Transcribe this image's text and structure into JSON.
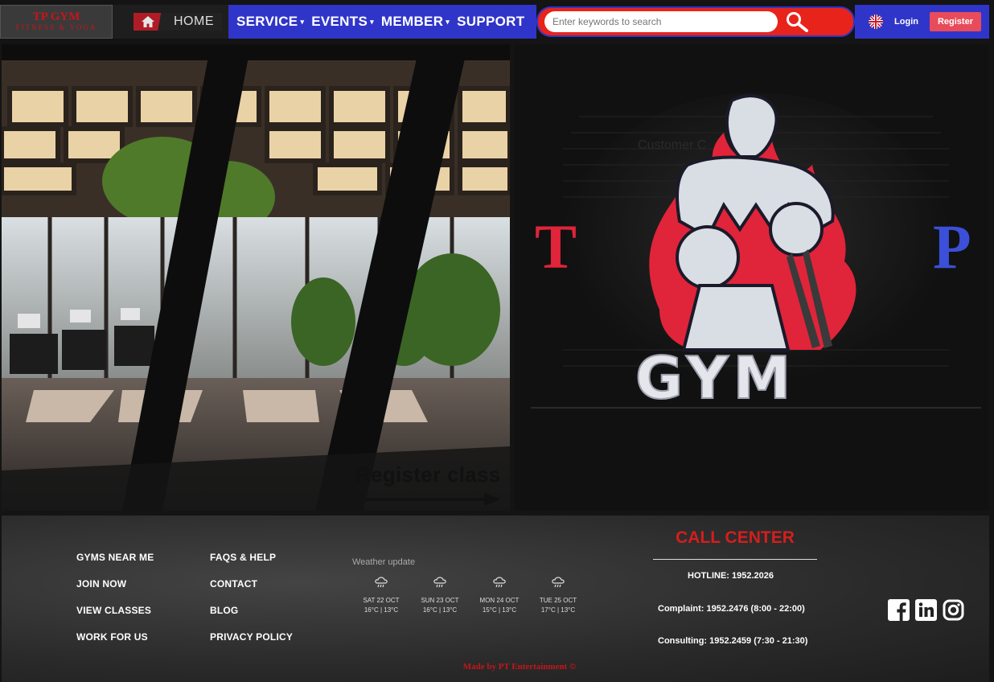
{
  "header": {
    "brand_title": "TP GYM",
    "brand_subtitle": "FITNESS & YOGA",
    "home_label": "HOME",
    "nav": [
      {
        "label": "SERVICE",
        "caret": "▾"
      },
      {
        "label": "EVENTS",
        "caret": "▾"
      },
      {
        "label": "MEMBER",
        "caret": "▾"
      },
      {
        "label": "SUPPORT",
        "caret": ""
      }
    ],
    "search_placeholder": "Enter keywords to search",
    "login_label": "Login",
    "register_label": "Register",
    "language_icon": "uk-flag-icon"
  },
  "hero": {
    "register_class_label": "Register class",
    "customer_label": "Customer C",
    "logo_text": "TP GYM"
  },
  "footer": {
    "links_col1": [
      "GYMS NEAR ME",
      "JOIN NOW",
      "VIEW CLASSES",
      "WORK FOR US"
    ],
    "links_col2": [
      "FAQS & HELP",
      "CONTACT",
      "BLOG",
      "PRIVACY POLICY"
    ],
    "weather_title": "Weather update",
    "weather": [
      {
        "day": "SAT 22 OCT",
        "temp": "16°C | 13°C"
      },
      {
        "day": "SUN 23 OCT",
        "temp": "16°C | 13°C"
      },
      {
        "day": "MON 24 OCT",
        "temp": "15°C | 13°C"
      },
      {
        "day": "TUE 25 OCT",
        "temp": "17°C | 13°C"
      }
    ],
    "call_center_title": "CALL CENTER",
    "hotline": "HOTLINE: 1952.2026",
    "complaint": "Complaint: 1952.2476 (8:00 - 22:00)",
    "consulting": "Consulting: 1952.2459 (7:30 - 21:30)",
    "socials": [
      "facebook-icon",
      "linkedin-icon",
      "instagram-icon"
    ],
    "made_by": "Made by PT Entertainment ©"
  },
  "colors": {
    "nav_blue": "#3035c9",
    "search_red": "#e8231b",
    "register_pink": "#e84b5a",
    "brand_red": "#c4161c",
    "call_center_red": "#d41e1e"
  }
}
